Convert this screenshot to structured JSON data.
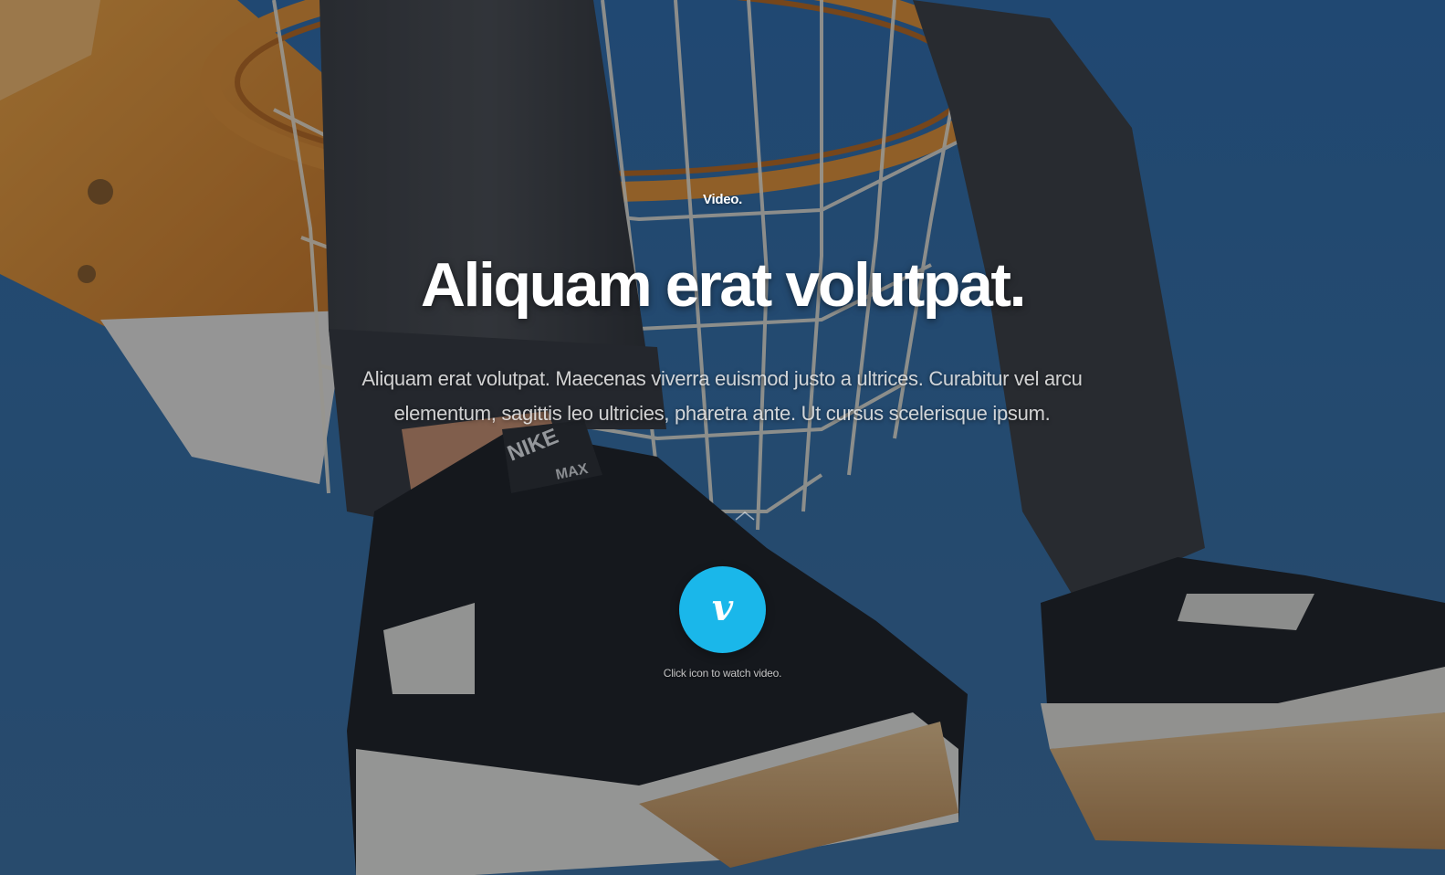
{
  "hero": {
    "eyebrow": "Video.",
    "headline": "Aliquam erat volutpat.",
    "lede": "Aliquam erat volutpat. Maecenas viverra euismod justo a ultrices. Curabitur vel arcu elementum, sagittis leo ultricies, pharetra ante. Ut cursus scelerisque ipsum.",
    "hint": "Click icon to watch video.",
    "background_image": "basketball-hoop-sneakers-photo"
  },
  "video_button": {
    "glyph": "v",
    "icon": "vimeo-icon",
    "color": "#1ab7ea"
  },
  "colors": {
    "sky": "#2f5f92",
    "rim_orange": "#e08a2c",
    "overlay": "#0a121c"
  }
}
